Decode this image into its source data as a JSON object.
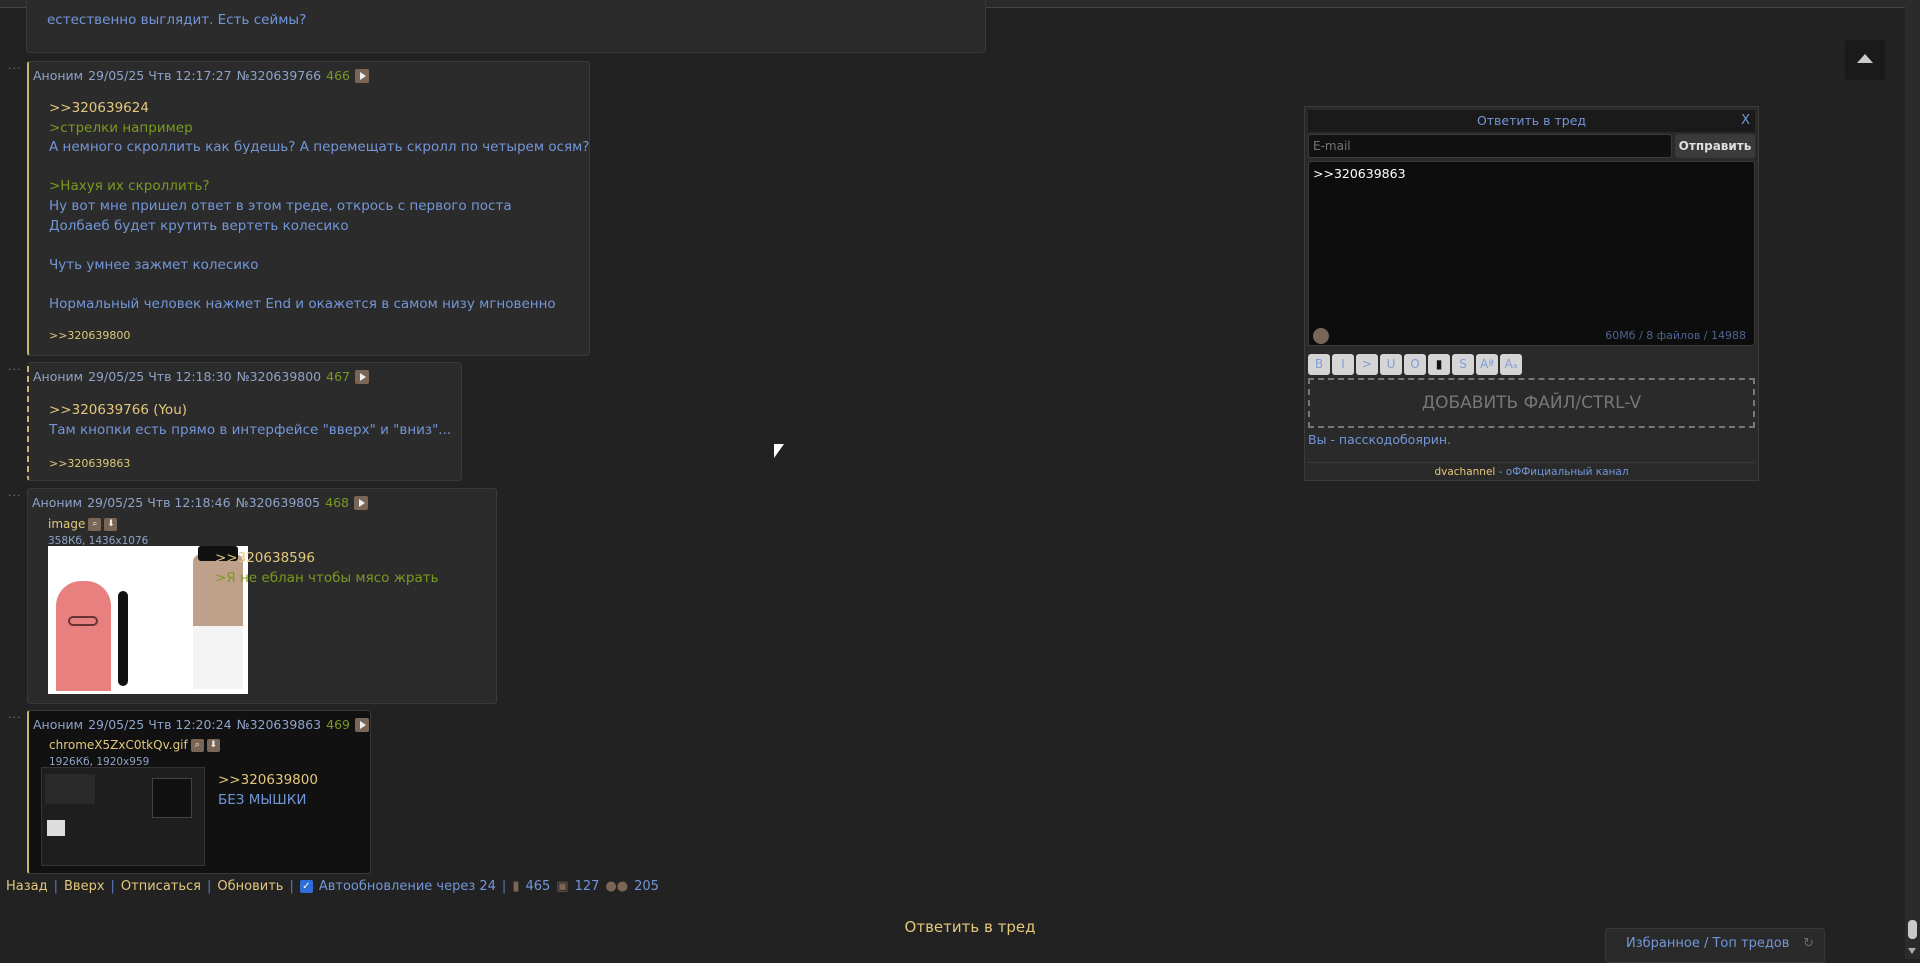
{
  "top_post": {
    "lines": [
      "естественно выглядит. Есть сеймы?"
    ]
  },
  "posts": [
    {
      "author": "Аноним",
      "date": "29/05/25 Чтв 12:17:27",
      "id": "№320639766",
      "num": "466",
      "lines": [
        {
          "t": "rl",
          "v": ">>320639624"
        },
        {
          "t": "gt",
          "v": ">стрелки например"
        },
        {
          "t": "n",
          "v": "А немного скроллить как будешь? А перемещать скролл по четырем осям?"
        },
        {
          "t": "n",
          "v": ""
        },
        {
          "t": "gt",
          "v": ">Нахуя их скроллить?"
        },
        {
          "t": "n",
          "v": "Ну вот мне пришел ответ в этом треде, открось с первого поста"
        },
        {
          "t": "n",
          "v": "Долбаеб будет крутить вертеть колесико"
        },
        {
          "t": "n",
          "v": ""
        },
        {
          "t": "n",
          "v": "Чуть умнее зажмет колесико"
        },
        {
          "t": "n",
          "v": ""
        },
        {
          "t": "n",
          "v": "Нормальный человек нажмет End и окажется в самом низу мгновенно"
        }
      ],
      "replies": ">>320639800"
    },
    {
      "author": "Аноним",
      "date": "29/05/25 Чтв 12:18:30",
      "id": "№320639800",
      "num": "467",
      "lines": [
        {
          "t": "rl",
          "v": ">>320639766 (You)"
        },
        {
          "t": "n",
          "v": "Там кнопки есть прямо в интерфейсе \"вверх\" и \"вниз\"..."
        }
      ],
      "replies": ">>320639863"
    },
    {
      "author": "Аноним",
      "date": "29/05/25 Чтв 12:18:46",
      "id": "№320639805",
      "num": "468",
      "file": {
        "name": "image",
        "size": "358Кб, 1436x1076"
      },
      "lines": [
        {
          "t": "rl",
          "v": ">>320638596"
        },
        {
          "t": "gt",
          "v": ">Я не еблан чтобы мясо жрать"
        }
      ]
    },
    {
      "author": "Аноним",
      "date": "29/05/25 Чтв 12:20:24",
      "id": "№320639863",
      "num": "469",
      "file": {
        "name": "chromeX5ZxC0tkQv.gif",
        "size": "1926Кб, 1920x959"
      },
      "lines": [
        {
          "t": "rl",
          "v": ">>320639800"
        },
        {
          "t": "n",
          "v": "БЕЗ МЫШКИ"
        }
      ]
    }
  ],
  "nav": {
    "back": "Назад",
    "up": "Вверх",
    "unsubscribe": "Отписаться",
    "refresh": "Обновить",
    "autoupdate": "Автообновление через 24",
    "posts": "465",
    "images": "127",
    "users": "205"
  },
  "reply_thread": "Ответить в тред",
  "form": {
    "title": "Ответить в тред",
    "close": "X",
    "email_placeholder": "E-mail",
    "submit": "Отправить",
    "message": ">>320639863",
    "limits": "60Мб / 8 файлов / 14988",
    "format_buttons": [
      "B",
      "I",
      ">",
      "U",
      "O",
      "▮",
      "S",
      "Aª",
      "Aₐ"
    ],
    "add_file": "ДОБАВИТЬ ФАЙЛ/CTRL-V",
    "passcode": "Вы - пасскодобоярин.",
    "channel_name": "dvachannel",
    "channel_text": " - оФФициальный канал"
  },
  "favorites": "Избранное / Топ тредов"
}
